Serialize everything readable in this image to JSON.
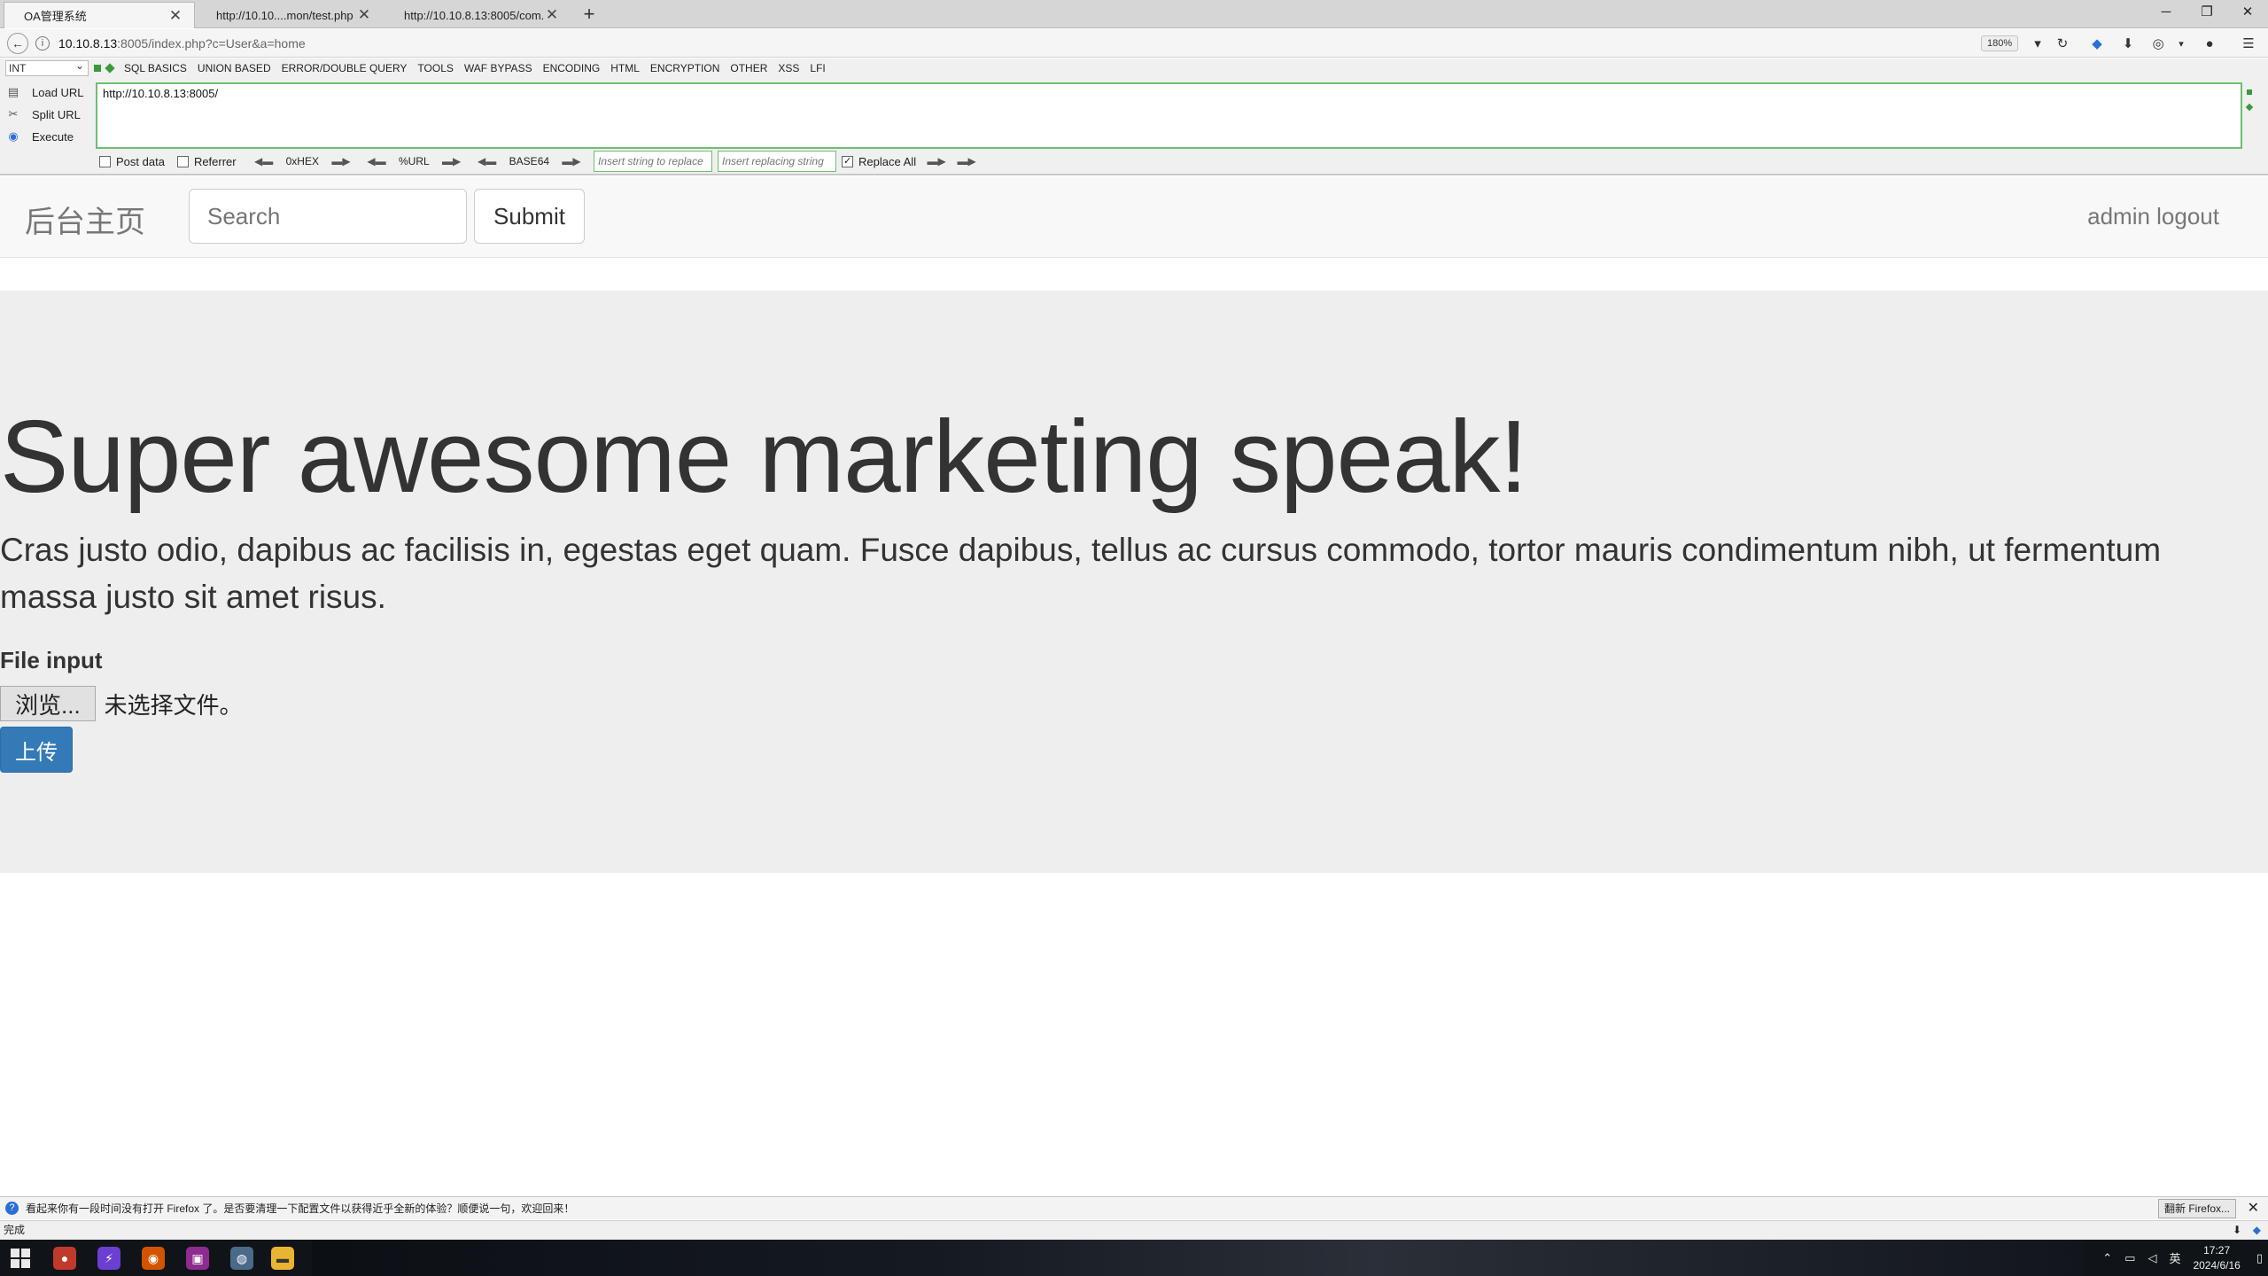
{
  "browser": {
    "tabs": [
      {
        "label": "OA管理系统",
        "active": true
      },
      {
        "label": "http://10.10....mon/test.php",
        "active": false
      },
      {
        "label": "http://10.10.8.13:8005/com...",
        "active": false
      }
    ],
    "url_host": "10.10.8.13",
    "url_rest": ":8005/index.php?c=User&a=home",
    "zoom": "180%"
  },
  "hackbar": {
    "select_value": "INT",
    "menu": [
      "SQL BASICS",
      "UNION BASED",
      "ERROR/DOUBLE QUERY",
      "TOOLS",
      "WAF BYPASS",
      "ENCODING",
      "HTML",
      "ENCRYPTION",
      "OTHER",
      "XSS",
      "LFI"
    ],
    "actions": {
      "load": "Load URL",
      "split": "Split URL",
      "execute": "Execute"
    },
    "url_value": "http://10.10.8.13:8005/",
    "post_data": "Post data",
    "referrer": "Referrer",
    "hex": "0xHEX",
    "url_enc": "%URL",
    "base64": "BASE64",
    "replace_placeholder": "Insert string to replace",
    "replacing_placeholder": "Insert replacing string",
    "replace_all": "Replace All"
  },
  "site": {
    "brand": "后台主页",
    "search_placeholder": "Search",
    "submit_label": "Submit",
    "user_links": "admin logout"
  },
  "jumbotron": {
    "headline": "Super awesome marketing speak!",
    "lead": "Cras justo odio, dapibus ac facilisis in, egestas eget quam. Fusce dapibus, tellus ac cursus commodo, tortor mauris condimentum nibh, ut fermentum massa justo sit amet risus.",
    "file_label": "File input",
    "browse_label": "浏览...",
    "no_file_text": "未选择文件。",
    "upload_label": "上传"
  },
  "notification": {
    "text": "看起来你有一段时间没有打开 Firefox 了。是否要清理一下配置文件以获得近乎全新的体验？顺便说一句，欢迎回来！",
    "button": "翻新 Firefox..."
  },
  "status": "完成",
  "taskbar": {
    "ime": "英",
    "time": "17:27",
    "date": "2024/6/16"
  },
  "colors": {
    "upload_button": "#337ab7",
    "hackbar_border": "#6fbf6f",
    "jumbotron_bg": "#eeeeee"
  }
}
